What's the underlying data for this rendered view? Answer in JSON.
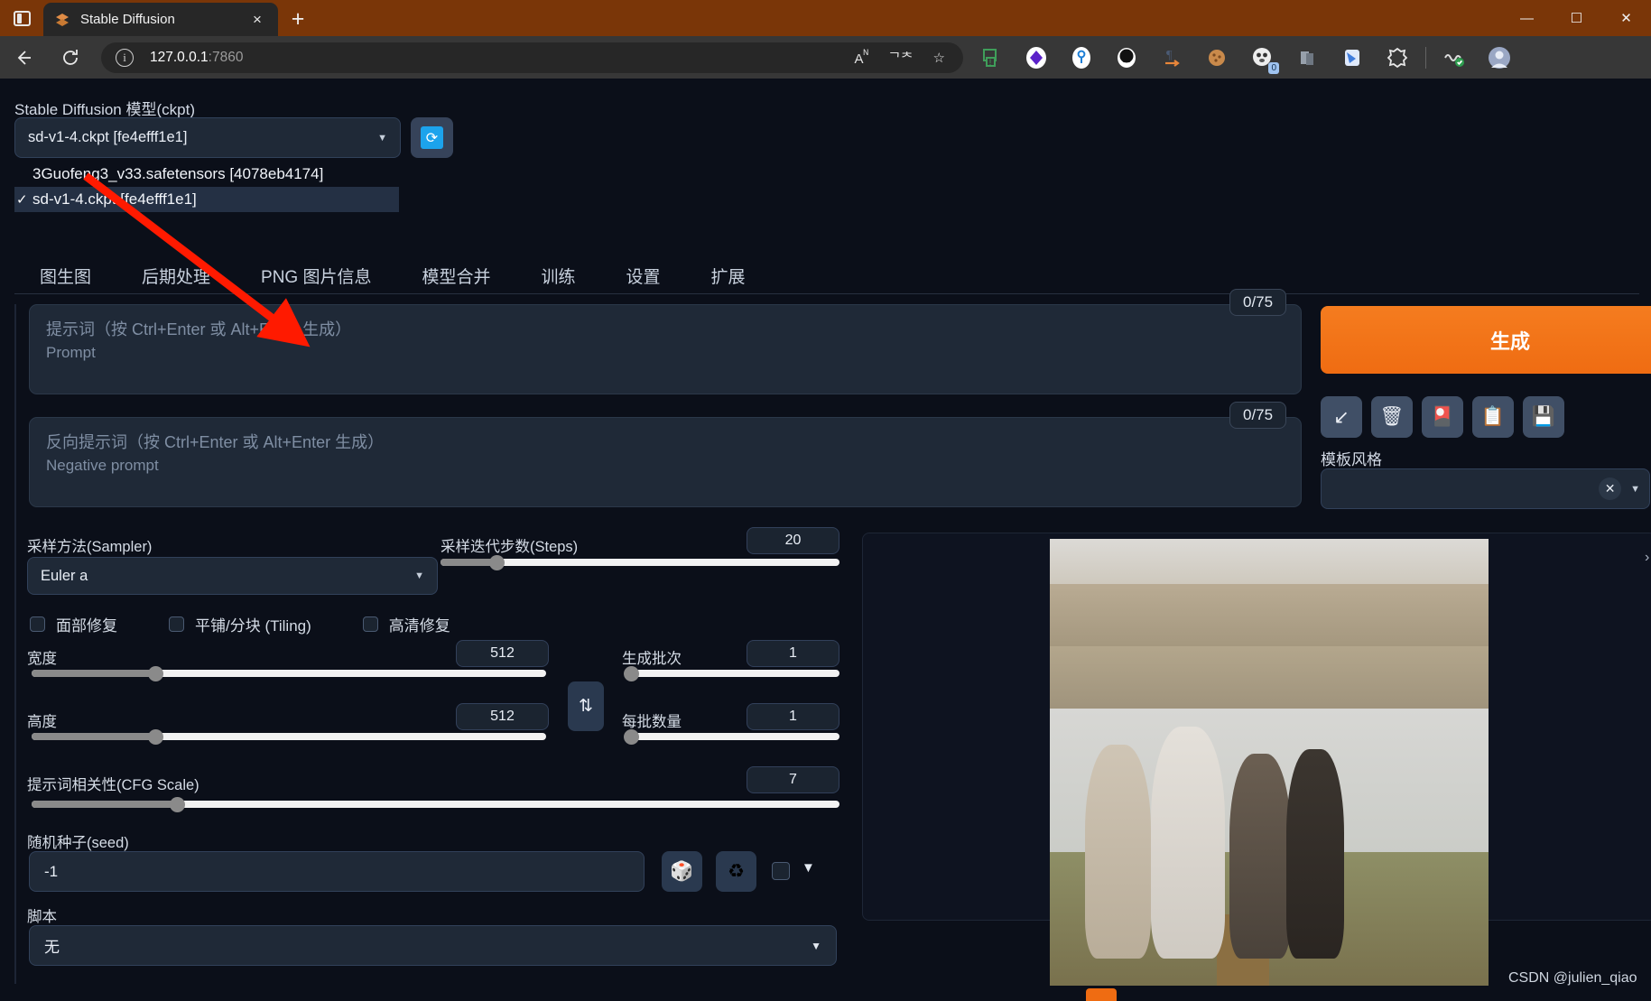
{
  "browser": {
    "tab_title": "Stable Diffusion",
    "tab_favicon_icon": "stable-diffusion-logo-icon",
    "sidebar_toggle_icon": "sidebar-toggle-icon",
    "new_tab_label": "+",
    "close_tab_label": "×",
    "back_icon": "back-arrow-icon",
    "reload_icon": "reload-icon",
    "info_icon": "info-circle-icon",
    "url_host": "127.0.0.1",
    "url_port": ":7860",
    "read_aloud_icon": "read-aloud-icon",
    "translate_icon": "translate-icon",
    "favorite_icon": "star-icon",
    "window_minimize": "—",
    "window_maximize": "☐",
    "window_close": "✕",
    "extensions": [
      {
        "name": "screen-capture-icon",
        "glyph": "❐",
        "color": "#3f9e5a",
        "badge": ""
      },
      {
        "name": "purple-diamond-icon",
        "glyph": "◆",
        "color": "#5b21c9",
        "badge": ""
      },
      {
        "name": "keyring-icon",
        "glyph": "⚷",
        "color": "#1c7ed6",
        "badge": ""
      },
      {
        "name": "panda-icon",
        "glyph": "●●",
        "color": "#111111",
        "badge": ""
      },
      {
        "name": "pilcrow-arrow-icon",
        "glyph": "¶",
        "color": "#e8863a",
        "badge": ""
      },
      {
        "name": "cookie-icon",
        "glyph": "●",
        "color": "#c98a4b",
        "badge": ""
      },
      {
        "name": "panda-counter-icon",
        "glyph": "◑",
        "color": "#d8d8d8",
        "badge": "0"
      },
      {
        "name": "copy-docs-icon",
        "glyph": "❐",
        "color": "#97a0ab",
        "badge": ""
      },
      {
        "name": "blue-bird-icon",
        "glyph": "◢",
        "color": "#3f7ddc",
        "badge": ""
      },
      {
        "name": "puzzle-extension-icon",
        "glyph": "⬡",
        "color": "#e8e8e8",
        "badge": ""
      },
      {
        "name": "heartbeat-check-icon",
        "glyph": "⚕",
        "color": "#d8d8d8",
        "badge": ""
      },
      {
        "name": "profile-avatar-icon",
        "glyph": "●",
        "color": "#9aa7c4",
        "badge": ""
      }
    ]
  },
  "model": {
    "label": "Stable Diffusion 模型(ckpt)",
    "selected": "sd-v1-4.ckpt [fe4efff1e1]",
    "refresh_icon": "refresh-models-icon",
    "dropdown_open": true,
    "options": [
      {
        "label": "3Guofeng3_v33.safetensors [4078eb4174]",
        "selected": false
      },
      {
        "label": "sd-v1-4.ckpt [fe4efff1e1]",
        "selected": true
      }
    ],
    "check_glyph": "✓"
  },
  "tabs": [
    {
      "label": "图生图",
      "active": true
    },
    {
      "label": "后期处理",
      "active": false
    },
    {
      "label": "PNG 图片信息",
      "active": false
    },
    {
      "label": "模型合并",
      "active": false
    },
    {
      "label": "训练",
      "active": false
    },
    {
      "label": "设置",
      "active": false
    },
    {
      "label": "扩展",
      "active": false
    }
  ],
  "prompt": {
    "positive_placeholder_line1": "提示词（按 Ctrl+Enter 或 Alt+Enter 生成）",
    "positive_placeholder_line2": "Prompt",
    "positive_value": "",
    "negative_placeholder_line1": "反向提示词（按 Ctrl+Enter 或 Alt+Enter 生成）",
    "negative_placeholder_line2": "Negative prompt",
    "negative_value": "",
    "positive_counter": "0/75",
    "negative_counter": "0/75"
  },
  "actions": {
    "generate_label": "生成",
    "generate_color": "#ef6c12",
    "icons": [
      {
        "name": "read-generation-params-icon",
        "glyph": "↙"
      },
      {
        "name": "clear-prompt-trash-icon",
        "glyph": "🗑"
      },
      {
        "name": "extra-networks-icon",
        "glyph": "🎴"
      },
      {
        "name": "apply-style-clipboard-icon",
        "glyph": "📋"
      },
      {
        "name": "save-style-floppy-icon",
        "glyph": "💾"
      }
    ],
    "style_label": "模板风格",
    "style_value": "",
    "style_clear_glyph": "✕"
  },
  "settings": {
    "sampler_label": "采样方法(Sampler)",
    "sampler_value": "Euler a",
    "steps_label": "采样迭代步数(Steps)",
    "steps_value": "20",
    "steps_pct": 14,
    "checkboxes": [
      {
        "label": "面部修复",
        "checked": false
      },
      {
        "label": "平铺/分块 (Tiling)",
        "checked": false
      },
      {
        "label": "高清修复",
        "checked": false
      }
    ],
    "width_label": "宽度",
    "width_value": "512",
    "width_pct": 24,
    "height_label": "高度",
    "height_value": "512",
    "height_pct": 24,
    "swap_icon": "swap-dimensions-icon",
    "batch_count_label": "生成批次",
    "batch_count_value": "1",
    "batch_count_pct": 1,
    "batch_size_label": "每批数量",
    "batch_size_value": "1",
    "batch_size_pct": 1,
    "cfg_label": "提示词相关性(CFG Scale)",
    "cfg_value": "7",
    "cfg_pct": 18,
    "seed_label": "随机种子(seed)",
    "seed_value": "-1",
    "seed_dice_icon": "random-seed-dice-icon",
    "seed_recycle_icon": "reuse-seed-recycle-icon",
    "seed_extra_caret": "▼",
    "script_label": "脚本",
    "script_value": "无"
  },
  "result": {
    "image_alt": "generated-image-people-by-lake",
    "collapse_glyph": "›"
  },
  "watermark": "CSDN @julien_qiao"
}
